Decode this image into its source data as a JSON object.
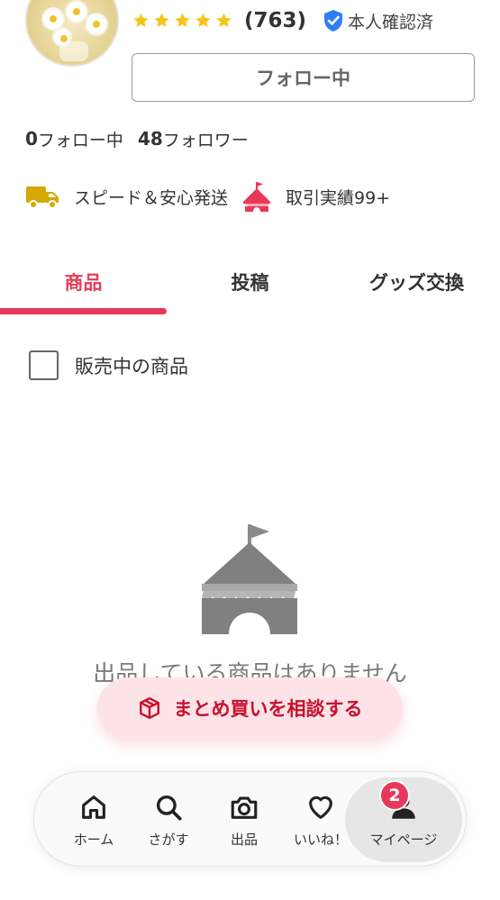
{
  "profile": {
    "rating_stars": 5,
    "review_count": "(763)",
    "verified_label": "本人確認済",
    "follow_button_label": "フォロー中",
    "following_count": "0",
    "following_label": "フォロー中",
    "followers_count": "48",
    "followers_label": "フォロワー",
    "badges": [
      {
        "icon": "truck-icon",
        "label": "スピード＆安心発送",
        "color": "#d4a800"
      },
      {
        "icon": "tent-icon",
        "label": "取引実績99+",
        "color": "#e8385a"
      }
    ]
  },
  "tabs": [
    {
      "label": "商品",
      "active": true
    },
    {
      "label": "投稿",
      "active": false
    },
    {
      "label": "グッズ交換",
      "active": false
    }
  ],
  "filter": {
    "label": "販売中の商品",
    "checked": false
  },
  "empty_state": {
    "icon": "tent-icon",
    "message": "出品している商品はありません"
  },
  "bundle_button": {
    "icon": "box-icon",
    "label": "まとめ買いを相談する"
  },
  "bottom_nav": {
    "items": [
      {
        "icon": "home-icon",
        "label": "ホーム"
      },
      {
        "icon": "search-icon",
        "label": "さがす"
      },
      {
        "icon": "camera-icon",
        "label": "出品"
      },
      {
        "icon": "heart-icon",
        "label": "いいね！"
      },
      {
        "icon": "person-icon",
        "label": "マイページ",
        "active": true
      }
    ],
    "notification_count": "2"
  },
  "colors": {
    "accent": "#e8385a",
    "star": "#f5c518",
    "verified": "#2f7ef5",
    "bundle_bg": "#fde3e7"
  }
}
